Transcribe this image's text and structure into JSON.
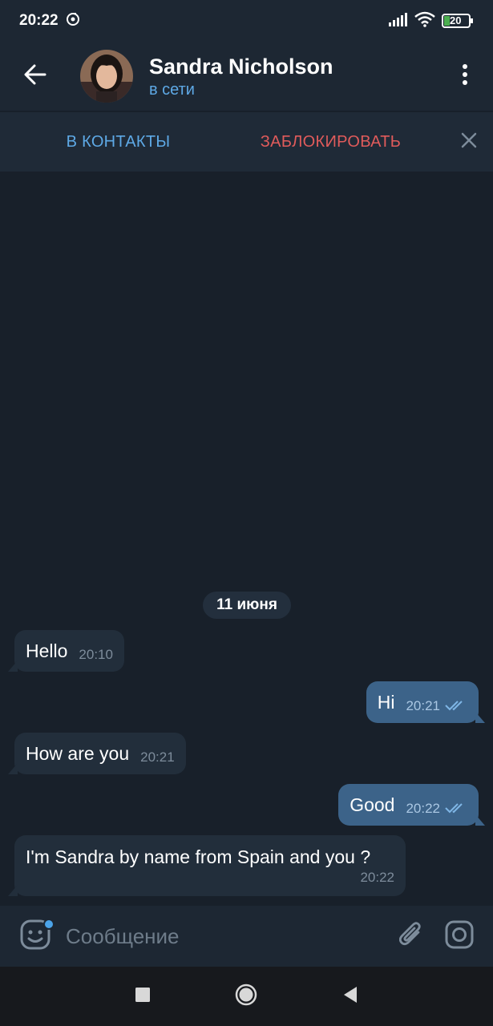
{
  "status_bar": {
    "time": "20:22",
    "battery": "20"
  },
  "header": {
    "name": "Sandra Nicholson",
    "status": "в сети"
  },
  "actions": {
    "add_contact": "В КОНТАКТЫ",
    "block": "ЗАБЛОКИРОВАТЬ"
  },
  "chat": {
    "date": "11 июня",
    "messages": [
      {
        "direction": "in",
        "text": "Hello",
        "time": "20:10"
      },
      {
        "direction": "out",
        "text": "Hi",
        "time": "20:21"
      },
      {
        "direction": "in",
        "text": "How are you",
        "time": "20:21"
      },
      {
        "direction": "out",
        "text": "Good",
        "time": "20:22"
      },
      {
        "direction": "in",
        "text": "I'm Sandra by name from Spain and you ?",
        "time": "20:22"
      }
    ]
  },
  "composer": {
    "placeholder": "Сообщение"
  },
  "colors": {
    "accent": "#5ea9e6",
    "danger": "#e05b5b",
    "outgoing_bubble": "#3c6389",
    "incoming_bubble": "#222e3b",
    "background": "#18202a"
  }
}
